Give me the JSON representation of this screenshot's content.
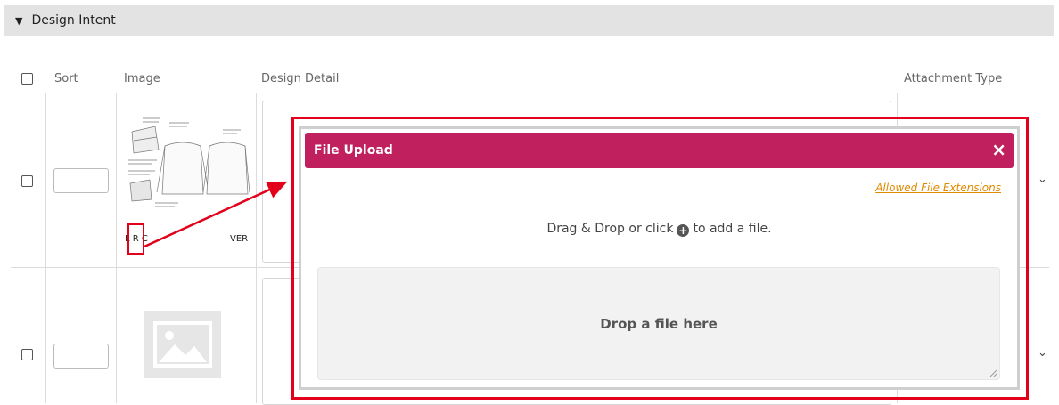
{
  "section": {
    "title": "Design Intent",
    "caret_icon": "caret-down-icon"
  },
  "table": {
    "columns": [
      "Sort",
      "Image",
      "Design Detail",
      "Attachment Type"
    ],
    "rows": [
      {
        "thumbnail_label_left": "L R C",
        "thumbnail_label_right": "VER"
      },
      {
        "thumbnail": "image-placeholder-icon"
      }
    ]
  },
  "dialog": {
    "title": "File Upload",
    "close_label": "×",
    "allowed_extensions_link": "Allowed File Extensions",
    "instruction_before": "Drag & Drop or click",
    "instruction_after": "to add a file.",
    "plus_glyph": "+",
    "dropzone_text": "Drop a file here"
  },
  "colors": {
    "dialog_header": "#c1205f",
    "highlight": "#e3001b",
    "link": "#e08a00"
  }
}
